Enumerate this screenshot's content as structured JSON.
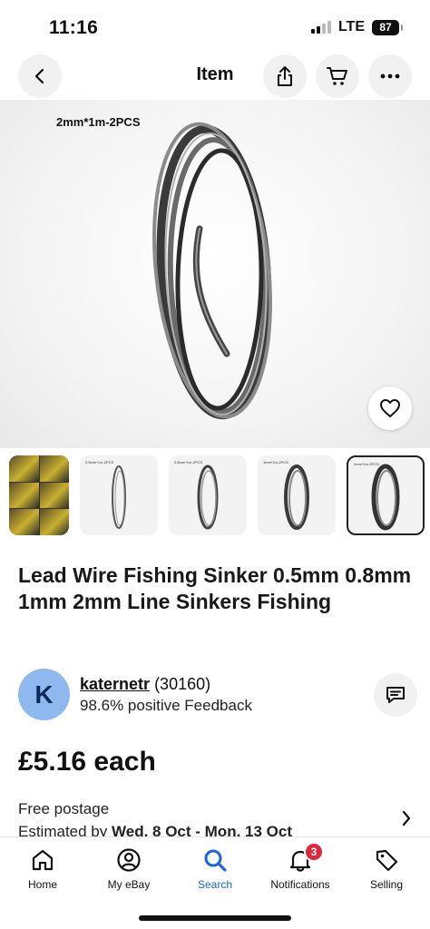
{
  "status_bar": {
    "time": "11:16",
    "network": "LTE",
    "battery": "87"
  },
  "nav": {
    "title": "Item",
    "icons": [
      "back-arrow-icon",
      "share-icon",
      "cart-icon",
      "more-icon"
    ]
  },
  "hero": {
    "caption": "2mm*1m-2PCS",
    "watch_icon": "heart-icon"
  },
  "thumbnails": [
    {
      "caption": ""
    },
    {
      "caption": "0.5mm*1m-2PCS"
    },
    {
      "caption": "0.8mm*1m-2PCS"
    },
    {
      "caption": "1mm*1m-2PCS"
    },
    {
      "caption": "2mm*1m-2PCS"
    }
  ],
  "listing": {
    "title": "Lead Wire Fishing Sinker 0.5mm 0.8mm 1mm 2mm Line Sinkers Fishing",
    "price": "£5.16 each"
  },
  "seller": {
    "initial": "K",
    "name": "katernetr",
    "rating_count": "(30160)",
    "feedback": "98.6% positive Feedback"
  },
  "shipping": {
    "line1": "Free postage",
    "line2_prefix": "Estimated by",
    "line2_dates": "Wed, 8 Oct - Mon, 13 Oct"
  },
  "tabs": [
    {
      "label": "Home",
      "icon": "home-icon"
    },
    {
      "label": "My eBay",
      "icon": "user-icon"
    },
    {
      "label": "Search",
      "icon": "search-icon"
    },
    {
      "label": "Notifications",
      "icon": "bell-icon",
      "badge": "3"
    },
    {
      "label": "Selling",
      "icon": "tag-icon"
    }
  ],
  "colors": {
    "accent": "#1a66d6",
    "badge": "#e0263c",
    "avatar": "#8fb8ee"
  }
}
